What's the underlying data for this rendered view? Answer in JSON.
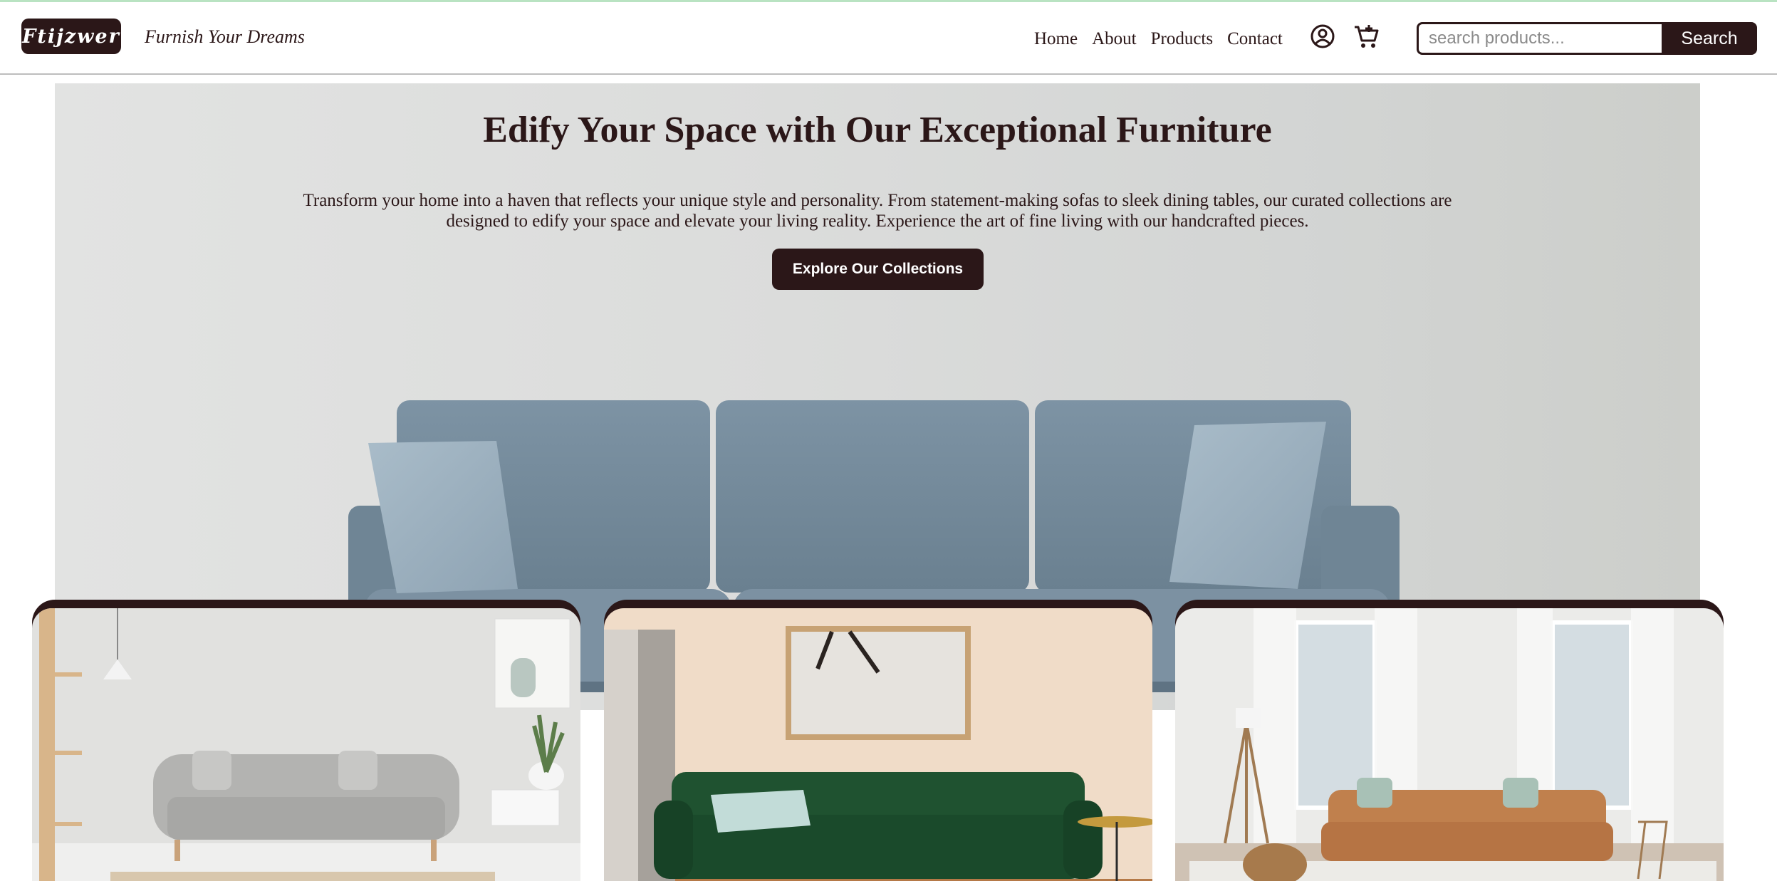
{
  "brand": {
    "logo_text": "Ftijzwer",
    "tagline": "Furnish Your Dreams"
  },
  "nav": {
    "items": [
      "Home",
      "About",
      "Products",
      "Contact"
    ]
  },
  "header_icons": [
    "user-account-icon",
    "shopping-cart-icon"
  ],
  "search": {
    "placeholder": "search products...",
    "button_label": "Search"
  },
  "hero": {
    "title": "Edify Your Space with Our Exceptional Furniture",
    "text": "Transform your home into a haven that reflects your unique style and personality. From statement-making sofas to sleek dining tables, our curated collections are designed to edify your space and elevate your living reality. Experience the art of fine living with our handcrafted pieces.",
    "cta_label": "Explore Our Collections"
  },
  "colors": {
    "brand_dark": "#2b1718",
    "hero_bg": "#dcdddc",
    "sofa_blue": "#7f95a6"
  }
}
